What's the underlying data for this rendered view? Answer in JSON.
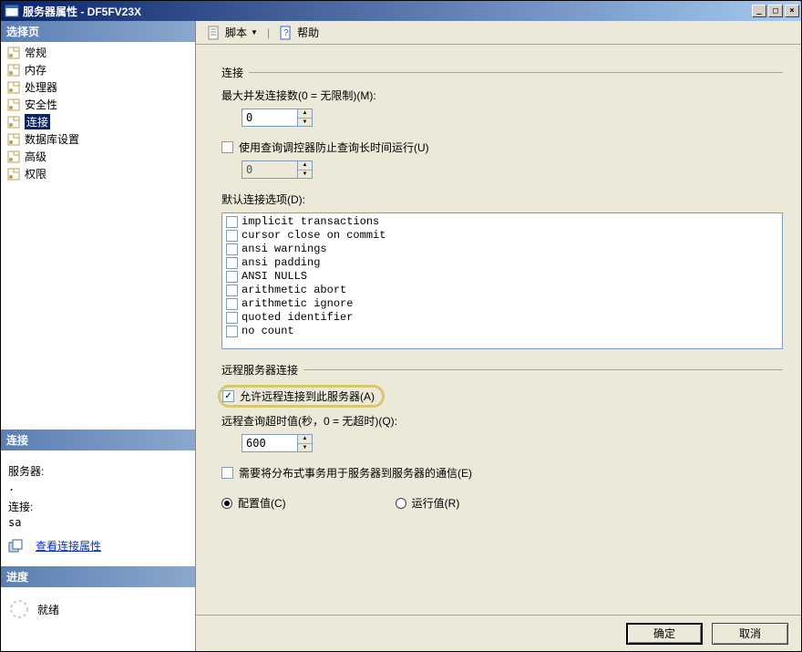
{
  "window": {
    "title": "服务器属性 - DF5FV23X"
  },
  "win_buttons": {
    "minimize": "_",
    "maximize": "□",
    "close": "×"
  },
  "sidebar": {
    "select_page_header": "选择页",
    "nav": [
      {
        "label": "常规",
        "icon": "page-icon"
      },
      {
        "label": "内存",
        "icon": "page-icon"
      },
      {
        "label": "处理器",
        "icon": "page-icon"
      },
      {
        "label": "安全性",
        "icon": "page-icon"
      },
      {
        "label": "连接",
        "icon": "page-icon",
        "selected": true
      },
      {
        "label": "数据库设置",
        "icon": "page-icon"
      },
      {
        "label": "高级",
        "icon": "page-icon"
      },
      {
        "label": "权限",
        "icon": "page-icon"
      }
    ],
    "connection_header": "连接",
    "server_label": "服务器:",
    "server_value": ".",
    "conn_label": "连接:",
    "conn_value": "sa",
    "view_props_link": "查看连接属性",
    "progress_header": "进度",
    "progress_status": "就绪"
  },
  "toolbar": {
    "script_label": "脚本",
    "help_label": "帮助"
  },
  "content": {
    "group_connections": "连接",
    "max_concurrent_label": "最大并发连接数(0 = 无限制)(M):",
    "max_concurrent_value": "0",
    "use_query_governor_label": "使用查询调控器防止查询长时间运行(U)",
    "query_governor_value": "0",
    "default_conn_options_label": "默认连接选项(D):",
    "options": [
      {
        "label": "implicit transactions",
        "checked": false
      },
      {
        "label": "cursor close on commit",
        "checked": false
      },
      {
        "label": "ansi warnings",
        "checked": false
      },
      {
        "label": "ansi padding",
        "checked": false
      },
      {
        "label": "ANSI NULLS",
        "checked": false
      },
      {
        "label": "arithmetic abort",
        "checked": false
      },
      {
        "label": "arithmetic ignore",
        "checked": false
      },
      {
        "label": "quoted identifier",
        "checked": false
      },
      {
        "label": "no count",
        "checked": false
      }
    ],
    "group_remote": "远程服务器连接",
    "allow_remote_label": "允许远程连接到此服务器(A)",
    "allow_remote_checked": true,
    "remote_timeout_label": "远程查询超时值(秒，0 = 无超时)(Q):",
    "remote_timeout_value": "600",
    "distrib_tx_label": "需要将分布式事务用于服务器到服务器的通信(E)",
    "radio_configured": "配置值(C)",
    "radio_running": "运行值(R)"
  },
  "footer": {
    "ok": "确定",
    "cancel": "取消"
  }
}
